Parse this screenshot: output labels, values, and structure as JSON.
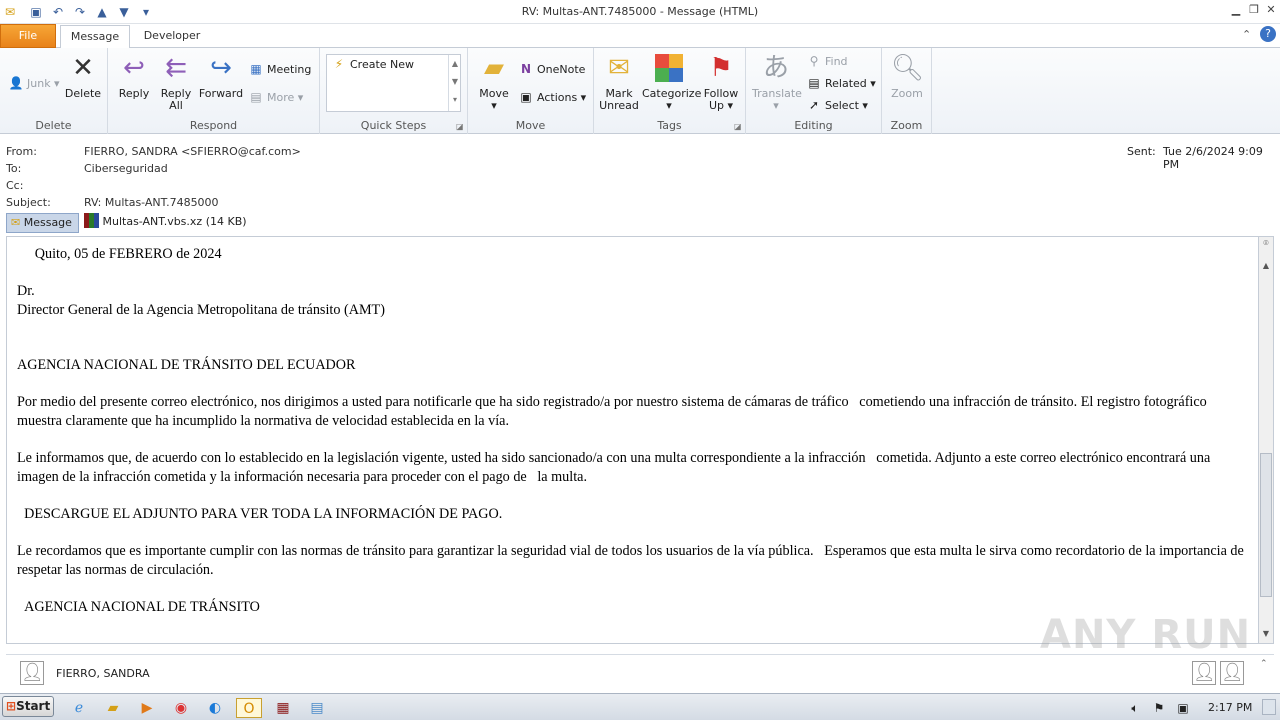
{
  "window": {
    "title": "RV: Multas-ANT.7485000  -  Message (HTML)"
  },
  "tabs": {
    "file": "File",
    "message": "Message",
    "developer": "Developer"
  },
  "ribbon": {
    "delete_group": {
      "label": "Delete",
      "junk": "Junk",
      "delete": "Delete"
    },
    "respond_group": {
      "label": "Respond",
      "reply": "Reply",
      "reply_all_1": "Reply",
      "reply_all_2": "All",
      "forward": "Forward",
      "meeting": "Meeting",
      "more": "More"
    },
    "quicksteps_group": {
      "label": "Quick Steps",
      "create_new": "Create New"
    },
    "move_group": {
      "label": "Move",
      "move": "Move",
      "onenote": "OneNote",
      "actions": "Actions"
    },
    "tags_group": {
      "label": "Tags",
      "mark_unread_1": "Mark",
      "mark_unread_2": "Unread",
      "categorize": "Categorize",
      "follow_up_1": "Follow",
      "follow_up_2": "Up"
    },
    "editing_group": {
      "label": "Editing",
      "translate": "Translate",
      "find": "Find",
      "related": "Related",
      "select": "Select"
    },
    "zoom_group": {
      "label": "Zoom",
      "zoom": "Zoom"
    }
  },
  "header": {
    "from_label": "From:",
    "from_value": "FIERRO, SANDRA <SFIERRO@caf.com>",
    "to_label": "To:",
    "to_value": "Ciberseguridad",
    "cc_label": "Cc:",
    "cc_value": "",
    "subject_label": "Subject:",
    "subject_value": "RV: Multas-ANT.7485000",
    "sent_label": "Sent:",
    "sent_value": "Tue 2/6/2024 9:09 PM"
  },
  "attachments": {
    "message_tab": "Message",
    "file": "Multas-ANT.vbs.xz (14 KB)"
  },
  "body": {
    "date_line": "     Quito, 05 de FEBRERO de 2024",
    "dr": "Dr.",
    "director": "Director General de la Agencia Metropolitana de tránsito (AMT)",
    "agency_heading": "AGENCIA NACIONAL DE TRÁNSITO DEL ECUADOR",
    "para1": "Por medio del presente correo electrónico, nos dirigimos a usted para notificarle que ha sido registrado/a por nuestro sistema de cámaras de tráfico   cometiendo una infracción de tránsito. El registro fotográfico muestra claramente que ha incumplido la normativa de velocidad establecida en la vía.",
    "para2": "Le informamos que, de acuerdo con lo establecido en la legislación vigente, usted ha sido sancionado/a con una multa correspondiente a la infracción   cometida. Adjunto a este correo electrónico encontrará una imagen de la infracción cometida y la información necesaria para proceder con el pago de   la multa.",
    "download": "  DESCARGUE EL ADJUNTO PARA VER TODA LA INFORMACIÓN DE PAGO.",
    "para3": "Le recordamos que es importante cumplir con las normas de tránsito para garantizar la seguridad vial de todos los usuarios de la vía pública.   Esperamos que esta multa le sirva como recordatorio de la importancia de respetar las normas de circulación.",
    "signature": "  AGENCIA NACIONAL DE TRÁNSITO"
  },
  "people_pane": {
    "name": "FIERRO, SANDRA"
  },
  "taskbar": {
    "start": "Start",
    "clock": "2:17 PM"
  },
  "watermark": "ANY RUN",
  "colors": {
    "file_tab": "#e8821a",
    "accent": "#3a5f9a"
  }
}
